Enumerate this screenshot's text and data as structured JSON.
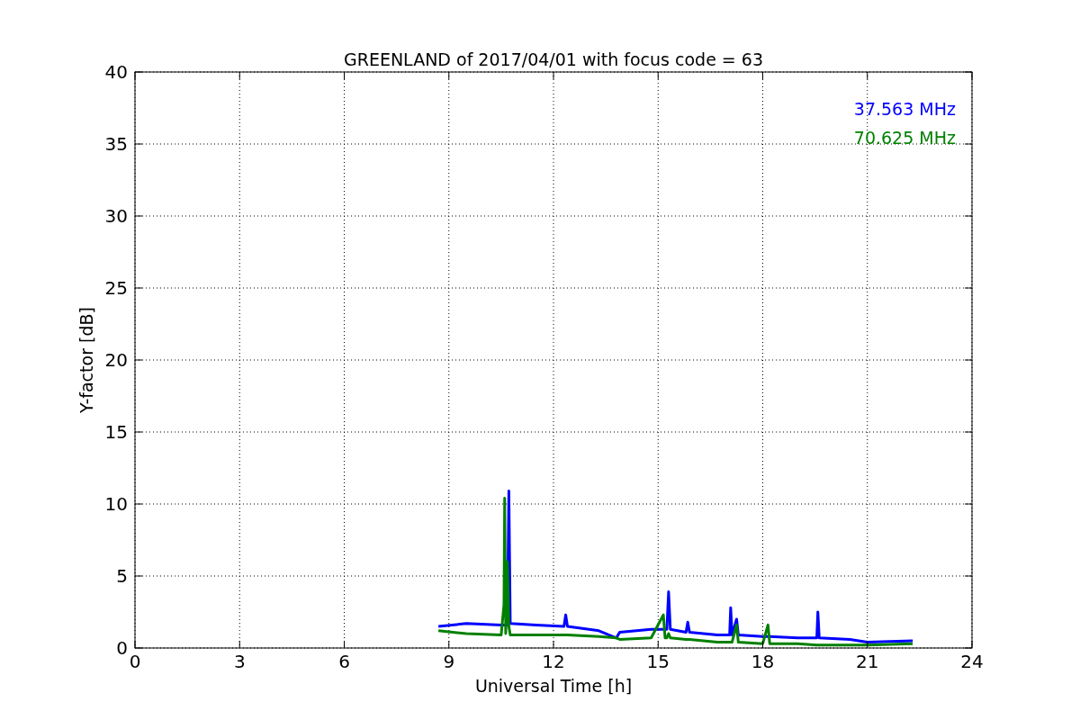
{
  "chart_data": {
    "type": "line",
    "title": "GREENLAND of 2017/04/01 with focus code = 63",
    "xlabel": "Universal Time [h]",
    "ylabel": "Y-factor [dB]",
    "x": [
      8.7,
      9.5,
      10.5,
      10.58,
      10.6,
      10.63,
      10.68,
      10.72,
      10.76,
      11.5,
      12.3,
      12.35,
      12.4,
      13.3,
      13.8,
      13.9,
      14.8,
      15.15,
      15.2,
      15.25,
      15.3,
      15.35,
      15.8,
      15.85,
      15.9,
      16.7,
      17.05,
      17.08,
      17.12,
      17.25,
      17.3,
      18.0,
      18.15,
      18.2,
      19.0,
      19.55,
      19.58,
      19.62,
      20.5,
      21.0,
      22.3
    ],
    "series": [
      {
        "name": "37.563 MHz",
        "color": "#0000ff",
        "values": [
          1.5,
          1.7,
          1.6,
          1.6,
          1.6,
          1.6,
          1.6,
          10.9,
          1.7,
          1.6,
          1.5,
          2.3,
          1.5,
          1.2,
          0.7,
          1.1,
          1.3,
          1.3,
          1.3,
          1.3,
          3.9,
          1.3,
          1.1,
          1.8,
          1.1,
          0.9,
          0.9,
          2.8,
          0.9,
          2.0,
          0.9,
          0.8,
          0.8,
          0.8,
          0.7,
          0.7,
          2.5,
          0.7,
          0.6,
          0.4,
          0.5
        ]
      },
      {
        "name": "70.625 MHz",
        "color": "#008000",
        "values": [
          1.2,
          1.0,
          0.9,
          3.0,
          10.4,
          1.0,
          6.0,
          1.5,
          0.9,
          0.9,
          0.9,
          0.9,
          0.9,
          0.8,
          0.7,
          0.6,
          0.7,
          2.3,
          0.7,
          0.7,
          1.0,
          0.7,
          0.6,
          0.6,
          0.6,
          0.4,
          0.4,
          0.4,
          0.4,
          1.6,
          0.4,
          0.3,
          1.6,
          0.3,
          0.3,
          0.2,
          0.2,
          0.2,
          0.2,
          0.2,
          0.3
        ]
      }
    ],
    "grid": true,
    "xlim": [
      0,
      24
    ],
    "ylim": [
      0,
      40
    ],
    "xticks": [
      0,
      3,
      6,
      9,
      12,
      15,
      18,
      21,
      24
    ],
    "yticks": [
      0,
      5,
      10,
      15,
      20,
      25,
      30,
      35,
      40
    ]
  }
}
